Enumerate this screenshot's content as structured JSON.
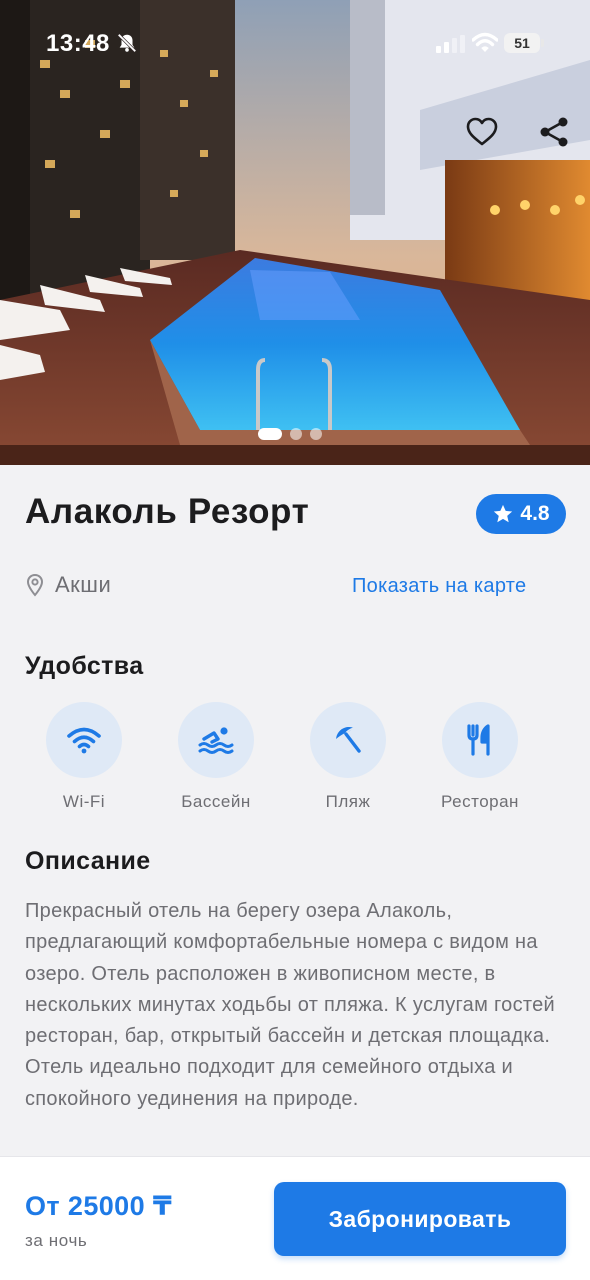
{
  "status_bar": {
    "time": "13:48",
    "battery": "51"
  },
  "hero": {
    "slides_count": 3,
    "active_slide": 1
  },
  "hotel": {
    "name": "Алаколь Резорт",
    "rating": "4.8",
    "location": "Акши",
    "map_link": "Показать на карте"
  },
  "amenities": {
    "title": "Удобства",
    "items": [
      {
        "label": "Wi-Fi",
        "icon": "wifi-icon"
      },
      {
        "label": "Бассейн",
        "icon": "pool-icon"
      },
      {
        "label": "Пляж",
        "icon": "beach-umbrella-icon"
      },
      {
        "label": "Ресторан",
        "icon": "restaurant-icon"
      }
    ]
  },
  "description": {
    "title": "Описание",
    "text": "Прекрасный отель на берегу озера Алаколь, предлагающий комфортабельные номера с видом на озеро. Отель расположен в живописном месте, в нескольких минутах ходьбы от пляжа. К услугам гостей ресторан, бар, открытый бассейн и детская площадка. Отель идеально подходит для семейного отдыха и спокойного уединения на природе."
  },
  "booking": {
    "price": "От 25000 ₸",
    "per_night": "за ночь",
    "button_label": "Забронировать"
  },
  "colors": {
    "accent": "#1e7ae6",
    "amenity_bg": "#dfe9f6",
    "page_bg": "#f2f2f4"
  }
}
